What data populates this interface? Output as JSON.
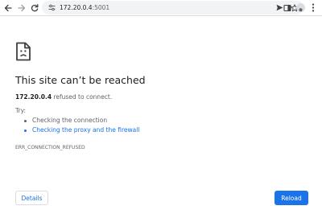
{
  "toolbar": {
    "url_host": "172.20.0.4",
    "url_port": ":5001"
  },
  "error": {
    "title": "This site can’t be reached",
    "host": "172.20.0.4",
    "message": " refused to connect.",
    "try_label": "Try:",
    "suggestions": [
      "Checking the connection",
      "Checking the proxy and the firewall"
    ],
    "code": "ERR_CONNECTION_REFUSED"
  },
  "buttons": {
    "details": "Details",
    "reload": "Reload"
  },
  "colors": {
    "accent": "#1a73e8",
    "text": "#202124",
    "muted": "#5f6368"
  },
  "icons": [
    "back-arrow-icon",
    "forward-arrow-icon",
    "reload-icon",
    "site-info-icon",
    "send-icon",
    "bookmark-star-icon",
    "side-panel-icon",
    "profile-avatar-icon",
    "kebab-menu-icon",
    "sad-page-icon"
  ]
}
